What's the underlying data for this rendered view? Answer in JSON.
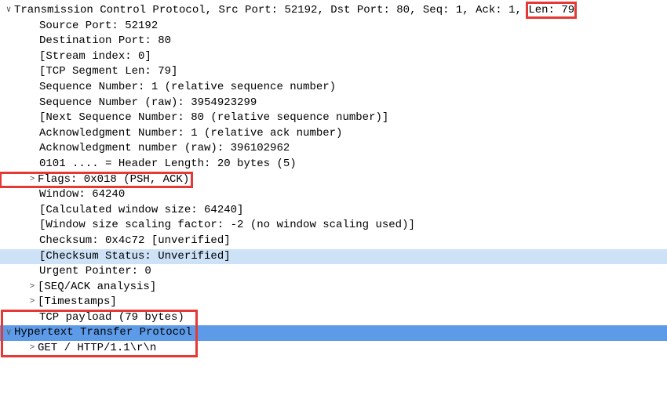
{
  "tcp": {
    "summary_prefix": "Transmission Control Protocol, Src Port: 52192, Dst Port: 80, Seq: 1, Ack: 1, ",
    "summary_len": "Len: 79",
    "source_port": "Source Port: 52192",
    "dest_port": "Destination Port: 80",
    "stream_index": "[Stream index: 0]",
    "segment_len": "[TCP Segment Len: 79]",
    "seq_rel": "Sequence Number: 1    (relative sequence number)",
    "seq_raw": "Sequence Number (raw): 3954923299",
    "next_seq": "[Next Sequence Number: 80    (relative sequence number)]",
    "ack_rel": "Acknowledgment Number: 1    (relative ack number)",
    "ack_raw": "Acknowledgment number (raw): 396102962",
    "hdr_len": "0101 .... = Header Length: 20 bytes (5)",
    "flags": "Flags: 0x018 (PSH, ACK)",
    "window": "Window: 64240",
    "calc_window": "[Calculated window size: 64240]",
    "scale_factor": "[Window size scaling factor: -2 (no window scaling used)]",
    "checksum": "Checksum: 0x4c72 [unverified]",
    "checksum_status": "[Checksum Status: Unverified]",
    "urgent_ptr": "Urgent Pointer: 0",
    "seq_ack_analysis": "[SEQ/ACK analysis]",
    "timestamps": "[Timestamps]",
    "payload": "TCP payload (79 bytes)"
  },
  "http": {
    "header": "Hypertext Transfer Protocol",
    "request_line": "GET / HTTP/1.1\\r\\n"
  },
  "toggles": {
    "open": "∨",
    "closed": ">"
  }
}
